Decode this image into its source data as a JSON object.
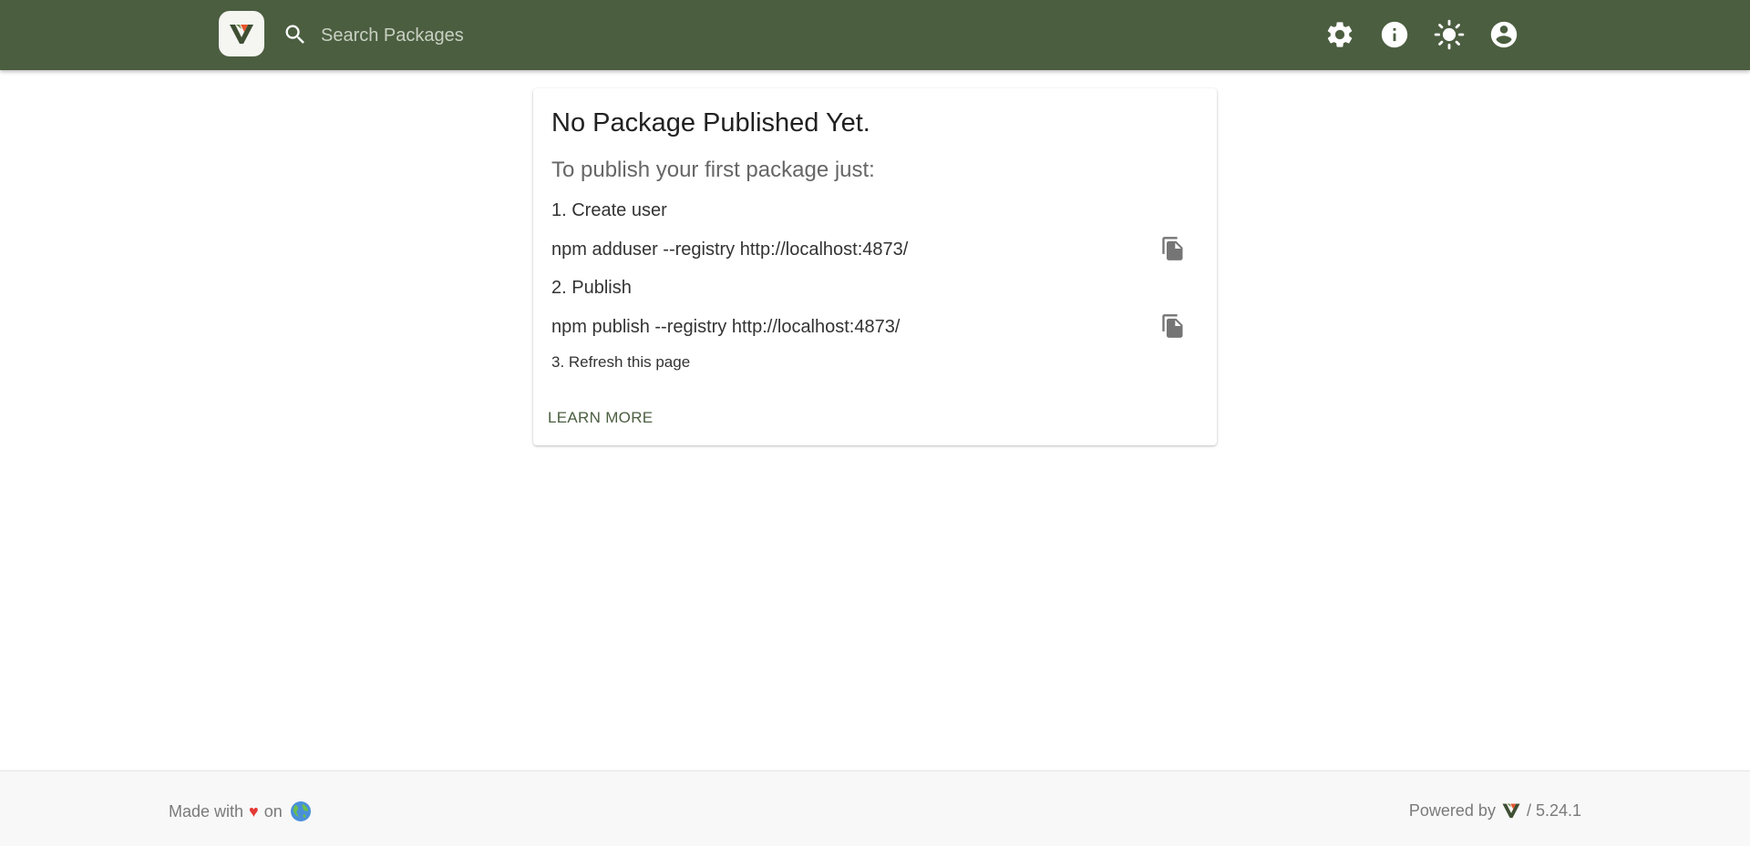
{
  "header": {
    "search_placeholder": "Search Packages",
    "brand_color": "#4b5e40",
    "icons": [
      "settings-icon",
      "info-icon",
      "theme-toggle-icon",
      "account-icon"
    ]
  },
  "card": {
    "title": "No Package Published Yet.",
    "subtitle": "To publish your first package just:",
    "step1": "1. Create user",
    "cmd1": "npm adduser --registry http://localhost:4873/",
    "step2": "2. Publish",
    "cmd2": "npm publish --registry http://localhost:4873/",
    "step3": "3. Refresh this page",
    "learn_more": "LEARN MORE"
  },
  "footer": {
    "made_with": "Made with",
    "on": "on",
    "powered_by": "Powered by",
    "version": "/ 5.24.1"
  }
}
